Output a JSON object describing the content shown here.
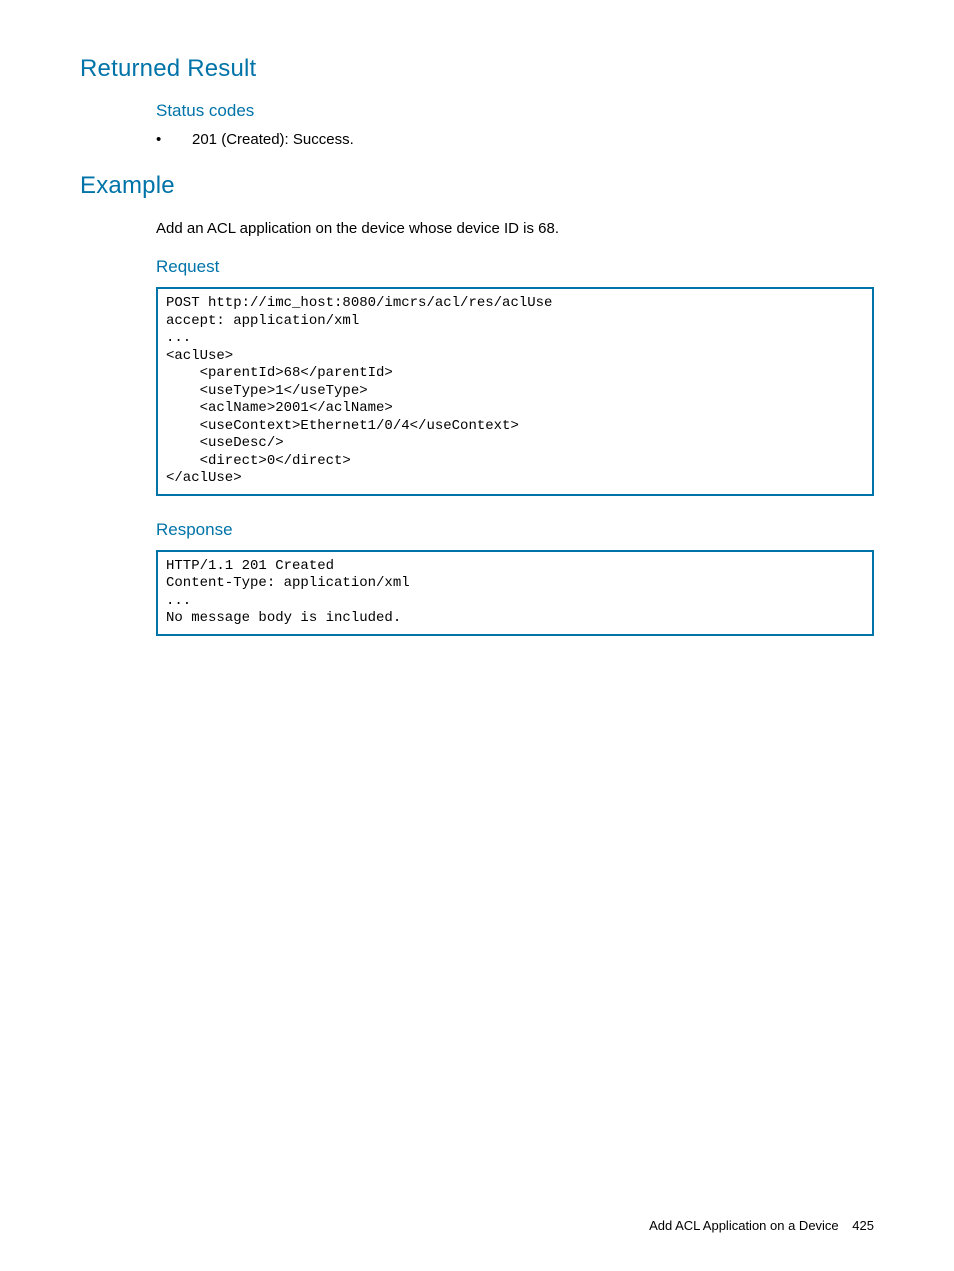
{
  "sections": {
    "returned_result": {
      "title": "Returned Result",
      "status_codes": {
        "heading": "Status codes",
        "item": "201 (Created): Success."
      }
    },
    "example": {
      "title": "Example",
      "intro": "Add an ACL application on the device whose device ID is 68.",
      "request": {
        "heading": "Request",
        "code": "POST http://imc_host:8080/imcrs/acl/res/aclUse\naccept: application/xml\n...\n<aclUse>\n    <parentId>68</parentId>\n    <useType>1</useType>\n    <aclName>2001</aclName>\n    <useContext>Ethernet1/0/4</useContext>\n    <useDesc/>\n    <direct>0</direct>\n</aclUse>"
      },
      "response": {
        "heading": "Response",
        "code": "HTTP/1.1 201 Created\nContent-Type: application/xml\n...\nNo message body is included."
      }
    }
  },
  "footer": {
    "label": "Add ACL Application on a Device",
    "page": "425"
  }
}
